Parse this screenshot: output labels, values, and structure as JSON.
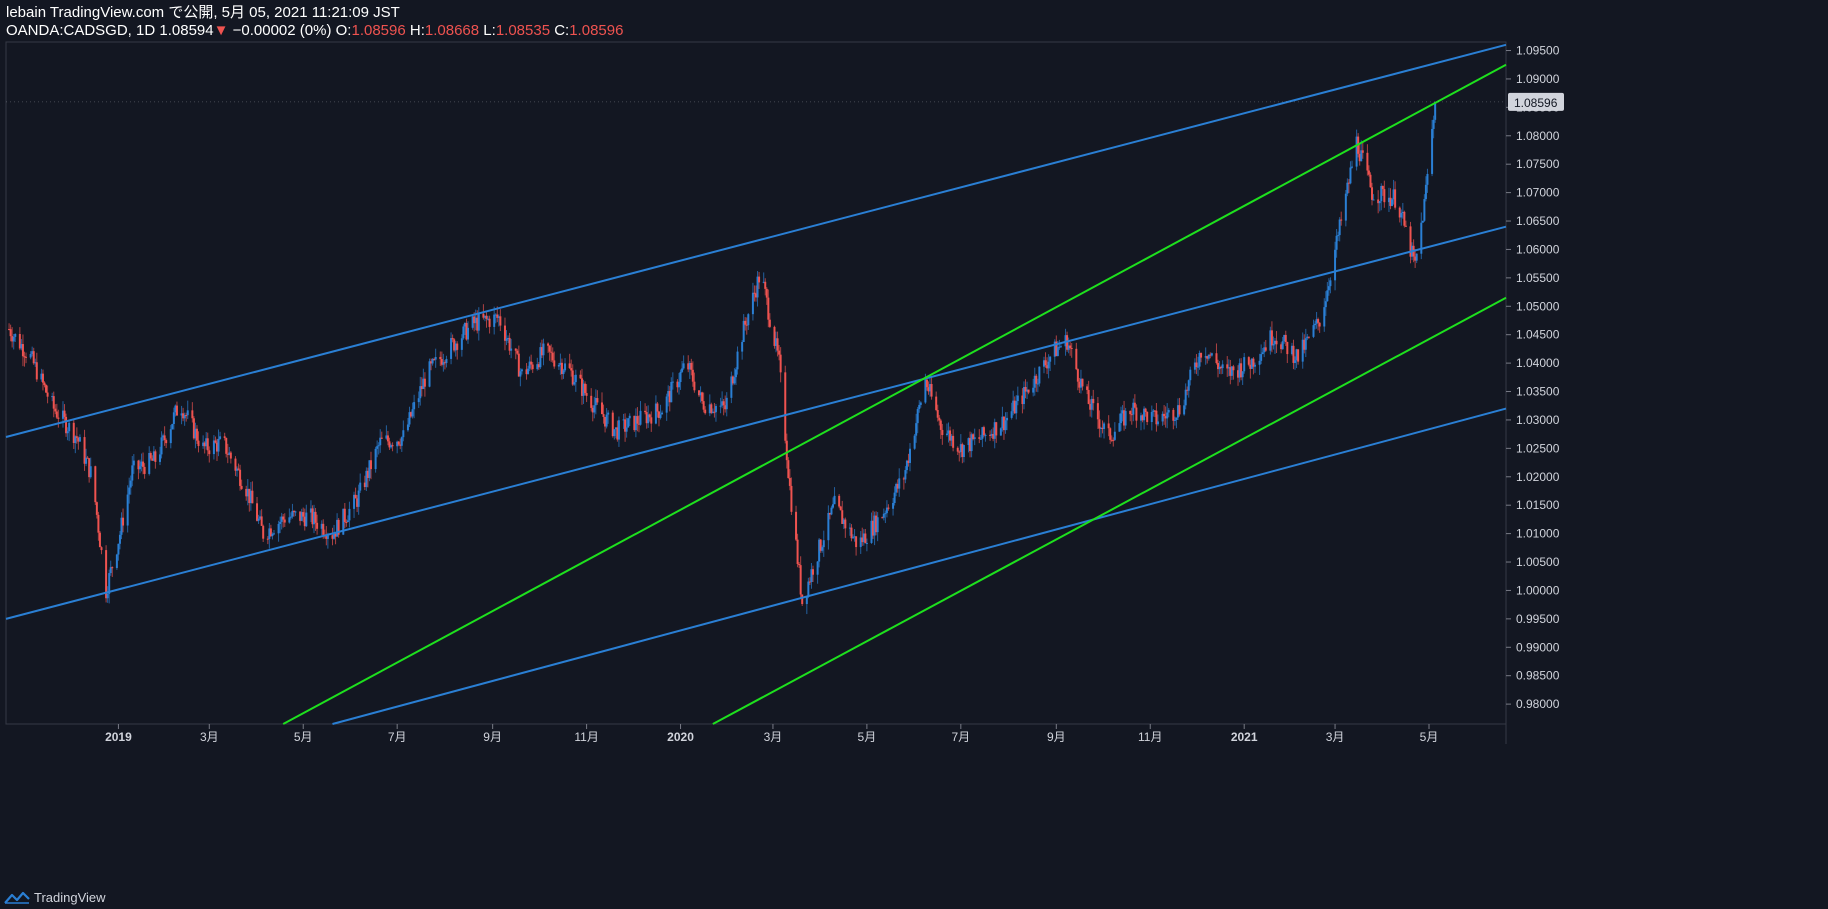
{
  "header": {
    "publisher": "lebain TradingView.com で公開, 5月 05, 2021 11:21:09 JST",
    "symbol": "OANDA:CADSGD, 1D",
    "last": "1.08594",
    "change": "−0.00002 (0%)",
    "o_label": "O:",
    "o_value": "1.08596",
    "h_label": "H:",
    "h_value": "1.08668",
    "l_label": "L:",
    "l_value": "1.08535",
    "c_label": "C:",
    "c_value": "1.08596"
  },
  "footer": {
    "brand": "TradingView"
  },
  "colors": {
    "background": "#131722",
    "up": "#2962ff",
    "up_candle": "#2a7fd4",
    "down": "#ef5350",
    "channel_blue": "#2a7fd4",
    "channel_green": "#1ee01e",
    "grid": "#363a45",
    "text": "#d1d4dc"
  },
  "chart_data": {
    "type": "candlestick",
    "ylim": [
      0.9765,
      1.0965
    ],
    "y_ticks": [
      "1.09500",
      "1.09000",
      "1.08500",
      "1.08000",
      "1.07500",
      "1.07000",
      "1.06500",
      "1.06000",
      "1.05500",
      "1.05000",
      "1.04500",
      "1.04000",
      "1.03500",
      "1.03000",
      "1.02500",
      "1.02000",
      "1.01500",
      "1.01000",
      "1.00500",
      "1.00000",
      "0.99500",
      "0.99000",
      "0.98500",
      "0.98000"
    ],
    "x_ticks": [
      {
        "label": "2019",
        "date": "2019-01-01",
        "bold": true
      },
      {
        "label": "3月",
        "date": "2019-03-01",
        "bold": false
      },
      {
        "label": "5月",
        "date": "2019-05-01",
        "bold": false
      },
      {
        "label": "7月",
        "date": "2019-07-01",
        "bold": false
      },
      {
        "label": "9月",
        "date": "2019-09-01",
        "bold": false
      },
      {
        "label": "11月",
        "date": "2019-11-01",
        "bold": false
      },
      {
        "label": "2020",
        "date": "2020-01-01",
        "bold": true
      },
      {
        "label": "3月",
        "date": "2020-03-01",
        "bold": false
      },
      {
        "label": "5月",
        "date": "2020-05-01",
        "bold": false
      },
      {
        "label": "7月",
        "date": "2020-07-01",
        "bold": false
      },
      {
        "label": "9月",
        "date": "2020-09-01",
        "bold": false
      },
      {
        "label": "11月",
        "date": "2020-11-01",
        "bold": false
      },
      {
        "label": "2021",
        "date": "2021-01-01",
        "bold": true
      },
      {
        "label": "3月",
        "date": "2021-03-01",
        "bold": false
      },
      {
        "label": "5月",
        "date": "2021-05-01",
        "bold": false
      }
    ],
    "x_range": [
      "2018-10-20",
      "2021-06-20"
    ],
    "last_price_label": "1.08596",
    "close_path": [
      [
        "2018-10-22",
        1.046
      ],
      [
        "2018-11-05",
        1.041
      ],
      [
        "2018-11-20",
        1.032
      ],
      [
        "2018-12-05",
        1.027
      ],
      [
        "2018-12-15",
        1.02
      ],
      [
        "2018-12-24",
        1.0
      ],
      [
        "2019-01-02",
        1.01
      ],
      [
        "2019-01-10",
        1.021
      ],
      [
        "2019-01-25",
        1.023
      ],
      [
        "2019-02-10",
        1.033
      ],
      [
        "2019-02-25",
        1.025
      ],
      [
        "2019-03-10",
        1.026
      ],
      [
        "2019-03-25",
        1.018
      ],
      [
        "2019-04-05",
        1.01
      ],
      [
        "2019-04-20",
        1.013
      ],
      [
        "2019-05-05",
        1.013
      ],
      [
        "2019-05-20",
        1.01
      ],
      [
        "2019-06-05",
        1.016
      ],
      [
        "2019-06-20",
        1.026
      ],
      [
        "2019-07-05",
        1.027
      ],
      [
        "2019-07-20",
        1.038
      ],
      [
        "2019-08-05",
        1.043
      ],
      [
        "2019-08-20",
        1.047
      ],
      [
        "2019-09-05",
        1.048
      ],
      [
        "2019-09-20",
        1.038
      ],
      [
        "2019-10-05",
        1.042
      ],
      [
        "2019-10-20",
        1.039
      ],
      [
        "2019-11-05",
        1.033
      ],
      [
        "2019-11-20",
        1.028
      ],
      [
        "2019-12-05",
        1.03
      ],
      [
        "2019-12-20",
        1.032
      ],
      [
        "2020-01-05",
        1.04
      ],
      [
        "2020-01-15",
        1.033
      ],
      [
        "2020-01-30",
        1.032
      ],
      [
        "2020-02-10",
        1.045
      ],
      [
        "2020-02-22",
        1.056
      ],
      [
        "2020-03-05",
        1.04
      ],
      [
        "2020-03-12",
        1.018
      ],
      [
        "2020-03-20",
        0.998
      ],
      [
        "2020-03-28",
        1.005
      ],
      [
        "2020-04-10",
        1.015
      ],
      [
        "2020-04-25",
        1.008
      ],
      [
        "2020-05-10",
        1.013
      ],
      [
        "2020-05-25",
        1.02
      ],
      [
        "2020-06-08",
        1.037
      ],
      [
        "2020-06-18",
        1.029
      ],
      [
        "2020-07-01",
        1.025
      ],
      [
        "2020-07-15",
        1.027
      ],
      [
        "2020-07-30",
        1.03
      ],
      [
        "2020-08-15",
        1.036
      ],
      [
        "2020-08-30",
        1.042
      ],
      [
        "2020-09-08",
        1.044
      ],
      [
        "2020-09-20",
        1.034
      ],
      [
        "2020-10-05",
        1.027
      ],
      [
        "2020-10-20",
        1.032
      ],
      [
        "2020-11-05",
        1.03
      ],
      [
        "2020-11-20",
        1.032
      ],
      [
        "2020-12-05",
        1.043
      ],
      [
        "2020-12-20",
        1.038
      ],
      [
        "2021-01-05",
        1.04
      ],
      [
        "2021-01-20",
        1.045
      ],
      [
        "2021-02-05",
        1.041
      ],
      [
        "2021-02-20",
        1.048
      ],
      [
        "2021-03-05",
        1.065
      ],
      [
        "2021-03-15",
        1.079
      ],
      [
        "2021-03-25",
        1.07
      ],
      [
        "2021-04-10",
        1.069
      ],
      [
        "2021-04-22",
        1.057
      ],
      [
        "2021-04-28",
        1.068
      ],
      [
        "2021-05-05",
        1.08596
      ]
    ],
    "trendlines": [
      {
        "color": "blue",
        "points": [
          [
            "2018-10-20",
            1.027
          ],
          [
            "2021-06-20",
            1.096
          ]
        ]
      },
      {
        "color": "blue",
        "points": [
          [
            "2018-10-20",
            0.995
          ],
          [
            "2021-06-20",
            1.064
          ]
        ]
      },
      {
        "color": "blue",
        "points": [
          [
            "2019-05-20",
            0.9765
          ],
          [
            "2021-06-20",
            1.032
          ]
        ]
      },
      {
        "color": "green",
        "points": [
          [
            "2019-04-18",
            0.9765
          ],
          [
            "2021-06-20",
            1.0925
          ]
        ]
      },
      {
        "color": "green",
        "points": [
          [
            "2020-01-22",
            0.9765
          ],
          [
            "2021-06-20",
            1.0515
          ]
        ]
      }
    ]
  }
}
